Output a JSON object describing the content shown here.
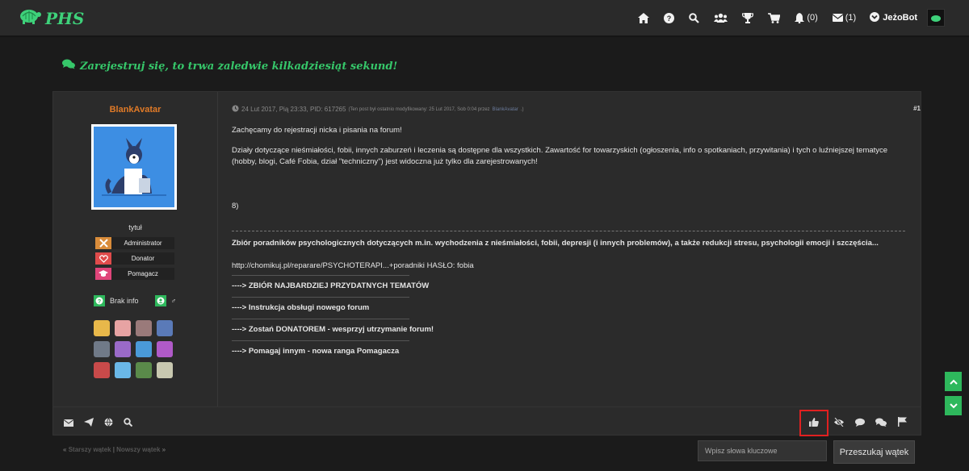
{
  "brand": {
    "name": "PHS",
    "accent": "#3ed17a"
  },
  "nav": {
    "notifications_count": "(0)",
    "messages_count": "(1)",
    "username": "JeżoBot"
  },
  "banner": {
    "text": "Zarejestruj się, to trwa zaledwie kilkadziesiąt sekund!"
  },
  "post": {
    "author": "BlankAvatar",
    "author_title": "tytuł",
    "ranks": [
      {
        "label": "Administrator",
        "color": "#d98c3a"
      },
      {
        "label": "Donator",
        "color": "#e04b4b"
      },
      {
        "label": "Pomagacz",
        "color": "#e0457a"
      }
    ],
    "info_label": "Brak info",
    "gender": "♂",
    "meta": {
      "date": "24 Lut 2017, Pią 23:33, PID: 617265",
      "edit_note": "(Ten post był ostatnio modyfikowany: 25 Lut 2017, Sob 0:04 przez",
      "editor": "BlankAvatar",
      "edit_close": ".)"
    },
    "number": "#1",
    "body": {
      "p1": "Zachęcamy do rejestracji nicka i pisania na forum!",
      "p2": "Działy dotyczące nieśmiałości, fobii, innych zaburzeń i leczenia są dostępne dla wszystkich. Zawartość for towarzyskich (ogłoszenia, info o spotkaniach, przywitania) i tych o luźniejszej tematyce (hobby, blogi, Café Fobia, dział \"techniczny\") jest widoczna już tylko dla zarejestrowanych!",
      "smiley": "8)"
    },
    "signature": {
      "guides": "Zbiór poradników psychologicznych dotyczących m.in. wychodzenia z nieśmiałości, fobii, depresji (i innych problemów), a także redukcji stresu, psychologii emocji i szczęścia...",
      "link": "http://chomikuj.pl/reparare/PSYCHOTERAPI...+poradniki",
      "password": "HASŁO: fobia",
      "lines": [
        "----> ZBIÓR NAJBARDZIEJ PRZYDATNYCH TEMATÓW",
        "----> Instrukcja obsługi nowego forum",
        "----> Zostań DONATOREM - wesprzyj utrzymanie forum!",
        "----> Pomagaj innym - nowa ranga Pomagacza"
      ]
    }
  },
  "thread_nav": {
    "prev_open": "«",
    "prev": "Starszy wątek",
    "divider": "|",
    "next": "Nowszy wątek",
    "next_close": "»"
  },
  "search": {
    "placeholder": "Wpisz słowa kluczowe",
    "button": "Przeszukaj wątek"
  },
  "colors": {
    "green": "#2eb85c",
    "highlight": "#e02020",
    "orange": "#e07a27"
  }
}
